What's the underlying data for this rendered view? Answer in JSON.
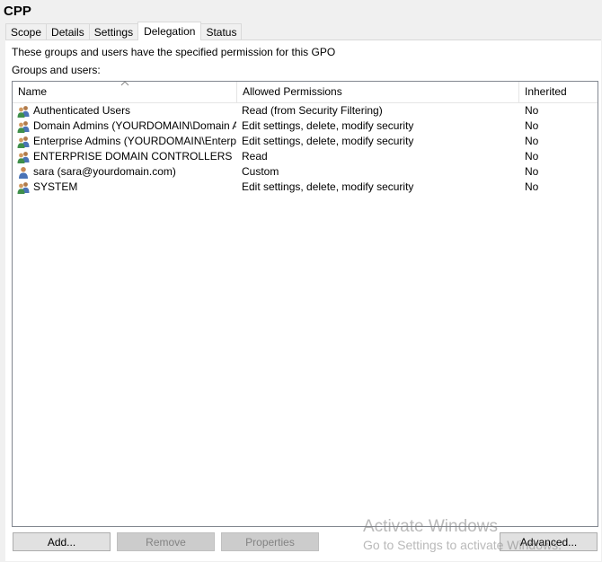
{
  "window": {
    "title": "CPP"
  },
  "tabs": [
    {
      "label": "Scope",
      "active": false
    },
    {
      "label": "Details",
      "active": false
    },
    {
      "label": "Settings",
      "active": false
    },
    {
      "label": "Delegation",
      "active": true
    },
    {
      "label": "Status",
      "active": false
    }
  ],
  "description": "These groups and users have the specified permission for this GPO",
  "groups_label": "Groups and users:",
  "table": {
    "columns": [
      "Name",
      "Allowed Permissions",
      "Inherited"
    ],
    "sort_column": "Name",
    "rows": [
      {
        "icon": "group-icon",
        "name": "Authenticated Users",
        "permission": "Read (from Security Filtering)",
        "inherited": "No"
      },
      {
        "icon": "group-icon",
        "name": "Domain Admins (YOURDOMAIN\\Domain Ad...",
        "permission": "Edit settings, delete, modify security",
        "inherited": "No"
      },
      {
        "icon": "group-icon",
        "name": "Enterprise Admins (YOURDOMAIN\\Enterpris...",
        "permission": "Edit settings, delete, modify security",
        "inherited": "No"
      },
      {
        "icon": "group-icon",
        "name": "ENTERPRISE DOMAIN CONTROLLERS",
        "permission": "Read",
        "inherited": "No"
      },
      {
        "icon": "user-icon",
        "name": "sara (sara@yourdomain.com)",
        "permission": "Custom",
        "inherited": "No"
      },
      {
        "icon": "group-icon",
        "name": "SYSTEM",
        "permission": "Edit settings, delete, modify security",
        "inherited": "No"
      }
    ]
  },
  "buttons": {
    "add": "Add...",
    "remove": "Remove",
    "properties": "Properties",
    "advanced": "Advanced..."
  },
  "watermark": {
    "title": "Activate Windows",
    "subtitle": "Go to Settings to activate Windows."
  }
}
